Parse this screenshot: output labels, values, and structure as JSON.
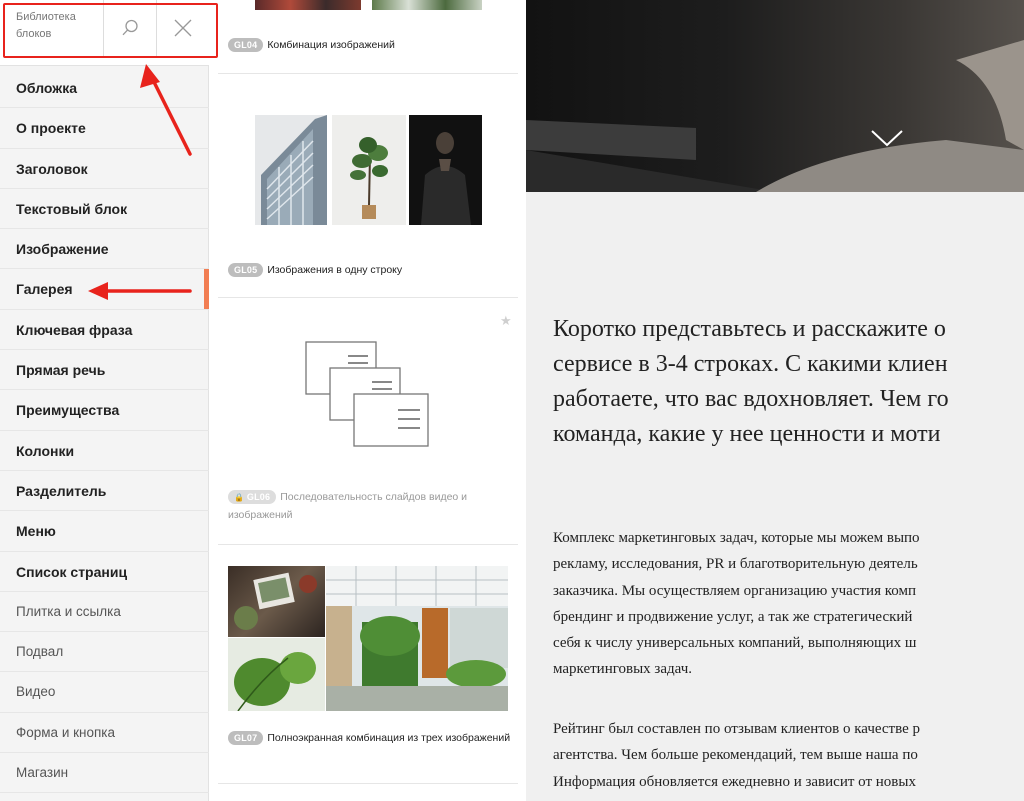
{
  "sidebar": {
    "library_title": "Библиотека блоков",
    "search_icon": "search-icon",
    "close_icon": "close-icon",
    "categories": [
      {
        "label": "Обложка"
      },
      {
        "label": "О проекте"
      },
      {
        "label": "Заголовок"
      },
      {
        "label": "Текстовый блок"
      },
      {
        "label": "Изображение"
      },
      {
        "label": "Галерея"
      },
      {
        "label": "Ключевая фраза"
      },
      {
        "label": "Прямая речь"
      },
      {
        "label": "Преимущества"
      },
      {
        "label": "Колонки"
      },
      {
        "label": "Разделитель"
      },
      {
        "label": "Меню"
      },
      {
        "label": "Список страниц"
      },
      {
        "label": "Плитка и ссылка"
      },
      {
        "label": "Подвал"
      },
      {
        "label": "Видео"
      },
      {
        "label": "Форма и кнопка"
      },
      {
        "label": "Магазин"
      }
    ],
    "active_category": "Галерея",
    "active_color": "#f27e53",
    "annotation_color": "#e8231c"
  },
  "blocks": [
    {
      "code": "GL04",
      "name": "Комбинация изображений"
    },
    {
      "code": "GL05",
      "name": "Изображения в одну строку"
    },
    {
      "code": "GL06",
      "name": "Последовательность слайдов видео и изображений",
      "locked": true,
      "favorite_icon": "star-icon"
    },
    {
      "code": "GL07",
      "name": "Полноэкранная комбинация из трех изображений"
    }
  ],
  "preview": {
    "hero_icon": "chevron-down-icon",
    "intro": [
      "Коротко представьтесь и расскажите о",
      "сервисе в 3-4 строках. С какими клиен",
      "работаете, что вас вдохновляет. Чем го",
      "команда, какие у нее ценности и моти"
    ],
    "paragraph1": [
      "Комплекс маркетинговых задач, которые мы можем выпо",
      "рекламу, исследования, PR и благотворительную деятель",
      "заказчика. Мы осуществляем организацию участия комп",
      "брендинг и продвижение услуг, а так же стратегический",
      "себя к числу универсальных компаний, выполняющих ш",
      "маркетинговых задач."
    ],
    "paragraph2": [
      "Рейтинг был составлен по отзывам клиентов о качестве р",
      "агентства. Чем больше рекомендаций, тем выше наша по",
      "Информация обновляется ежедневно и зависит от новых"
    ]
  }
}
